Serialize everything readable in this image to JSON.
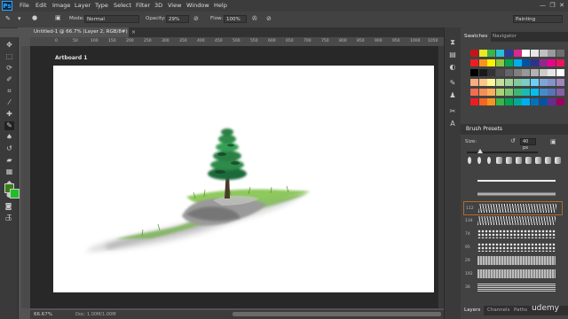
{
  "app": {
    "logo_text": "Ps"
  },
  "menu": [
    "File",
    "Edit",
    "Image",
    "Layer",
    "Type",
    "Select",
    "Filter",
    "3D",
    "View",
    "Window",
    "Help"
  ],
  "options_bar": {
    "mode_label": "Mode:",
    "mode_value": "Normal",
    "opacity_label": "Opacity:",
    "opacity_value": "29%",
    "flow_label": "Flow:",
    "flow_value": "100%",
    "workspace_value": "Painting"
  },
  "document": {
    "tab_title": "Untitled-1 @ 66.7% (Layer 2, RGB/8#) *",
    "artboard_label": "Artboard 1",
    "zoom": "66.67%",
    "doc_info": "Doc: 1.00M/1.00M"
  },
  "ruler_top": [
    "0",
    "50",
    "100",
    "150",
    "200",
    "250",
    "300",
    "350",
    "400",
    "450",
    "500",
    "550",
    "600",
    "650",
    "700",
    "750",
    "800",
    "850",
    "900",
    "950",
    "1000",
    "1050",
    "1100",
    "1150"
  ],
  "swatches_panel": {
    "tabs": [
      "Swatches",
      "Navigator"
    ],
    "rows": [
      [
        "#c3141b",
        "#e8e825",
        "#3ab34a",
        "#2abfd4",
        "#2a3b9c",
        "#d82a8c",
        "#ffffff",
        "#e6e6e6",
        "#c0c0c0",
        "#9a9a9a",
        "#6d6d6d"
      ],
      [
        "#ed1c24",
        "#f7941d",
        "#fff200",
        "#8dc63f",
        "#00a651",
        "#00aeef",
        "#0054a6",
        "#2e3192",
        "#92278f",
        "#ec008c",
        "#ed145b"
      ],
      [
        "#000000",
        "#1a1a1a",
        "#333333",
        "#4d4d4d",
        "#666666",
        "#808080",
        "#999999",
        "#b3b3b3",
        "#cccccc",
        "#e6e6e6",
        "#ffffff"
      ],
      [
        "#f9ad81",
        "#fdc689",
        "#fff79a",
        "#c4df9b",
        "#a3d39c",
        "#82ca9d",
        "#7bcdc8",
        "#6ecff6",
        "#7ea7d8",
        "#8493ca",
        "#a187be"
      ],
      [
        "#f26c4f",
        "#f68e56",
        "#fbaf5c",
        "#acd372",
        "#7cc576",
        "#3bb878",
        "#1abbb4",
        "#00bff3",
        "#438ccb",
        "#5574b9",
        "#8560a8"
      ],
      [
        "#ed1c24",
        "#f26522",
        "#f7941d",
        "#39b54a",
        "#00a651",
        "#00a99d",
        "#00aeef",
        "#0072bc",
        "#0054a6",
        "#662d91",
        "#9e005d"
      ]
    ]
  },
  "brush_presets": {
    "title": "Brush Presets",
    "size_label": "Size:",
    "size_value": "40 px",
    "tip_sizes": [
      "",
      "",
      "",
      "",
      "",
      "",
      "",
      "",
      "",
      ""
    ],
    "rows": [
      {
        "num": "",
        "type": "hard"
      },
      {
        "num": "",
        "type": "soft"
      },
      {
        "num": "112",
        "type": "grass"
      },
      {
        "num": "134",
        "type": "grass"
      },
      {
        "num": "74",
        "type": "splatter"
      },
      {
        "num": "95",
        "type": "splatter"
      },
      {
        "num": "29",
        "type": "chalk"
      },
      {
        "num": "192",
        "type": "chalk"
      },
      {
        "num": "36",
        "type": "dry"
      }
    ]
  },
  "bottom_panel_tabs": [
    "Layers",
    "Channels",
    "Paths"
  ],
  "watermark": "udemy"
}
